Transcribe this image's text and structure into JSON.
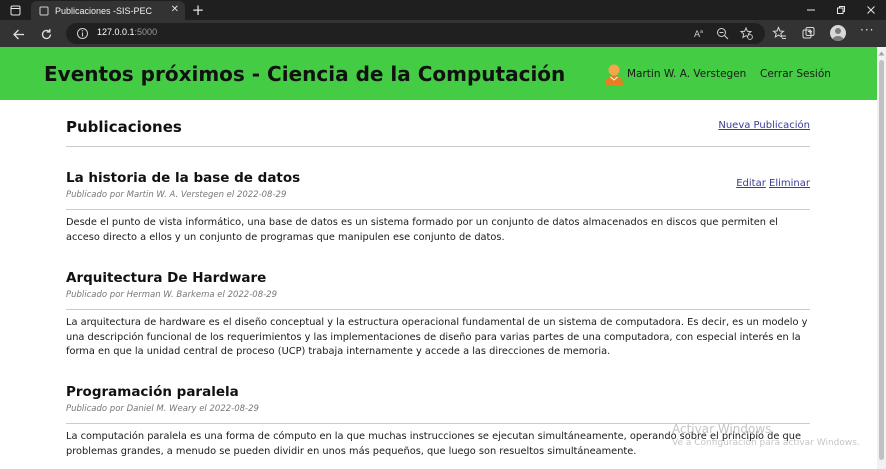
{
  "browser": {
    "tab_title": "Publicaciones -SIS-PEC",
    "url_host": "127.0.0.1",
    "url_port": ":5000"
  },
  "header": {
    "title": "Eventos próximos - Ciencia de la Computación",
    "user_name": "Martin W. A. Verstegen",
    "logout_label": "Cerrar Sesión",
    "background_color": "#44cc44"
  },
  "main": {
    "heading": "Publicaciones",
    "new_publication_label": "Nueva Publicación",
    "posts": [
      {
        "title": "La historia de la base de datos",
        "meta": "Publicado por Martin W. A. Verstegen el 2022-08-29",
        "edit_label": "Editar",
        "delete_label": "Eliminar",
        "body": "Desde el punto de vista informático, una base de datos es un sistema formado por un conjunto de datos almacenados en discos que permiten el acceso directo a ellos y un conjunto de programas que manipulen ese conjunto de datos."
      },
      {
        "title": "Arquitectura De Hardware",
        "meta": "Publicado por Herman W. Barkema el 2022-08-29",
        "body": "La arquitectura de hardware es el diseño conceptual y la estructura operacional fundamental de un sistema de computadora. Es decir, es un modelo y una descripción funcional de los requerimientos y las implementaciones de diseño para varias partes de una computadora, con especial interés en la forma en que la unidad central de proceso (UCP) trabaja internamente y accede a las direcciones de memoria."
      },
      {
        "title": "Programación paralela",
        "meta": "Publicado por Daniel M. Weary el 2022-08-29",
        "body": "La computación paralela es una forma de cómputo en la que muchas instrucciones se ejecutan simultáneamente,  operando sobre el principio de que problemas grandes, a menudo se pueden dividir en unos más pequeños, que luego son resueltos simultáneamente."
      }
    ]
  },
  "watermark": {
    "line1": "Activar Windows",
    "line2": "Ve a Configuración para activar Windows."
  }
}
